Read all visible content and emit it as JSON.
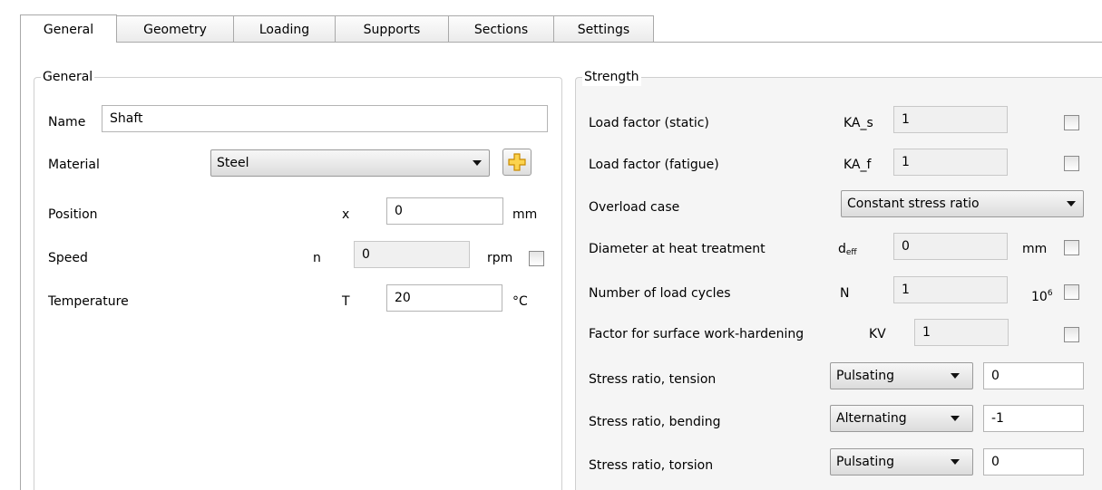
{
  "tabs": [
    "General",
    "Geometry",
    "Loading",
    "Supports",
    "Sections",
    "Settings"
  ],
  "general_group": {
    "legend": "General",
    "name_label": "Name",
    "name_value": "Shaft",
    "material_label": "Material",
    "material_value": "Steel",
    "position_label": "Position",
    "position_symbol": "x",
    "position_value": "0",
    "position_unit": "mm",
    "speed_label": "Speed",
    "speed_symbol": "n",
    "speed_value": "0",
    "speed_unit": "rpm",
    "temperature_label": "Temperature",
    "temperature_symbol": "T",
    "temperature_value": "20",
    "temperature_unit": "°C"
  },
  "strength_group": {
    "legend": "Strength",
    "load_static_label": "Load factor (static)",
    "load_static_symbol": "KA_s",
    "load_static_value": "1",
    "load_fatigue_label": "Load factor (fatigue)",
    "load_fatigue_symbol": "KA_f",
    "load_fatigue_value": "1",
    "overload_label": "Overload case",
    "overload_value": "Constant stress ratio",
    "diameter_label": "Diameter at heat treatment",
    "diameter_symbol": "d",
    "diameter_symbol_sub": "eff",
    "diameter_value": "0",
    "diameter_unit": "mm",
    "cycles_label": "Number of load cycles",
    "cycles_symbol": "N",
    "cycles_value": "1",
    "cycles_unit": "10",
    "cycles_unit_sup": "6",
    "surface_label": "Factor for surface work-hardening",
    "surface_symbol": "KV",
    "surface_value": "1",
    "tension_label": "Stress ratio, tension",
    "tension_type": "Pulsating",
    "tension_value": "0",
    "bending_label": "Stress ratio, bending",
    "bending_type": "Alternating",
    "bending_value": "-1",
    "torsion_label": "Stress ratio, torsion",
    "torsion_type": "Pulsating",
    "torsion_value": "0"
  },
  "icons": {
    "add": "add-plus-icon",
    "dropdown": "chevron-down-icon",
    "checkbox": "checkbox-icon"
  },
  "colors": {
    "add_icon_fill": "#fbd34e",
    "add_icon_stroke": "#c98a00",
    "readonly_field": "#f0f0f0"
  }
}
